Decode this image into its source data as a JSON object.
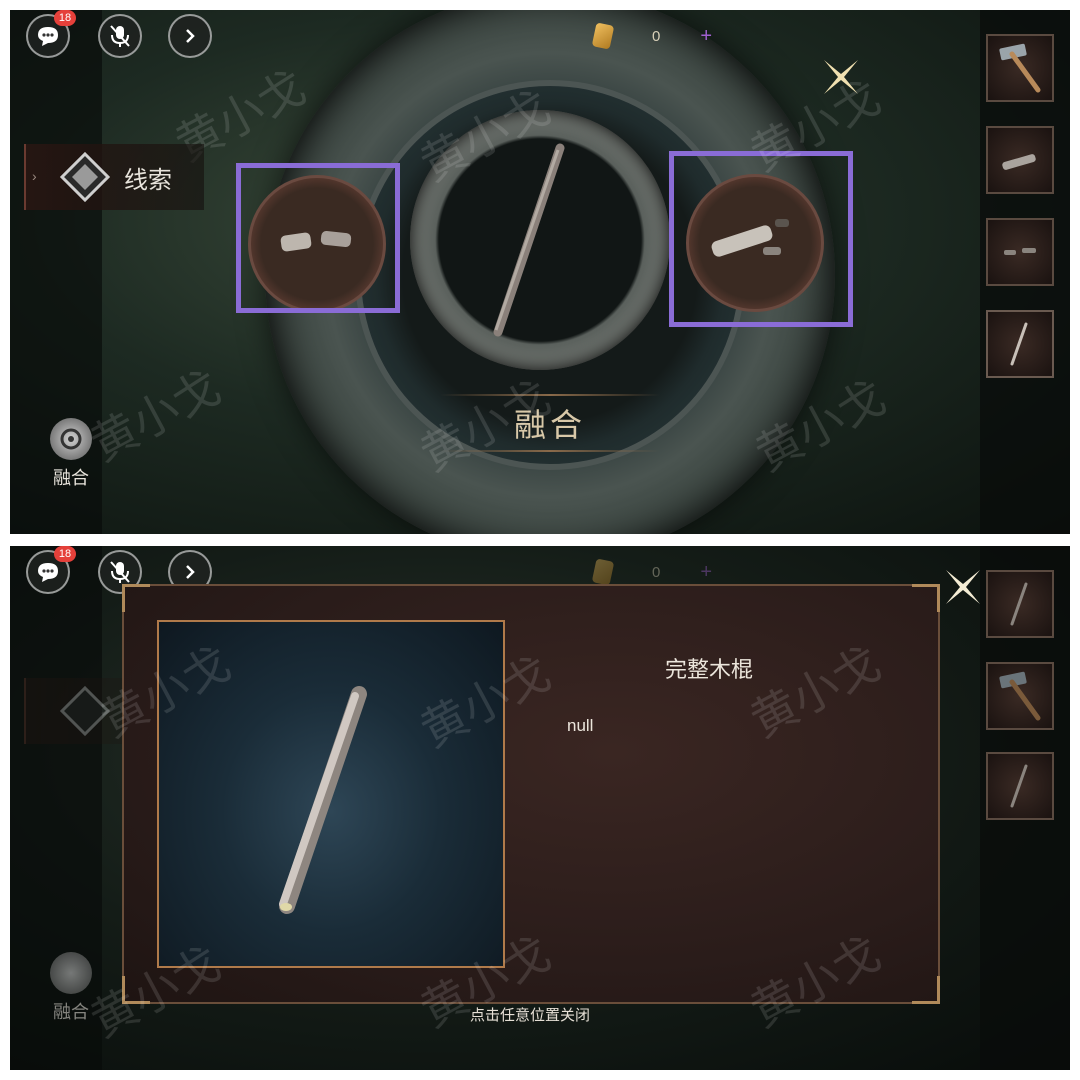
{
  "top": {
    "hud": {
      "chat_badge": "18",
      "currency_value": "0",
      "plus": "+"
    },
    "left_menu": {
      "clue_label": "线索",
      "fusion_label": "融合"
    },
    "fusion_button_label": "融合",
    "inventory": [
      "hammer-icon",
      "metal-piece-icon",
      "broken-stick-pieces-icon",
      "wooden-stick-icon"
    ],
    "watermark": "黄小戈",
    "highlight_color": "#8a6cd6"
  },
  "bottom": {
    "hud": {
      "chat_badge": "18",
      "currency_value": "0",
      "plus": "+"
    },
    "left_menu": {
      "fusion_label": "融合"
    },
    "inventory": [
      "wooden-stick-icon",
      "hammer-icon",
      "wooden-stick-icon"
    ],
    "modal": {
      "item_name": "完整木棍",
      "item_desc": "null",
      "close_hint": "点击任意位置关闭"
    },
    "watermark": "黄小戈"
  }
}
